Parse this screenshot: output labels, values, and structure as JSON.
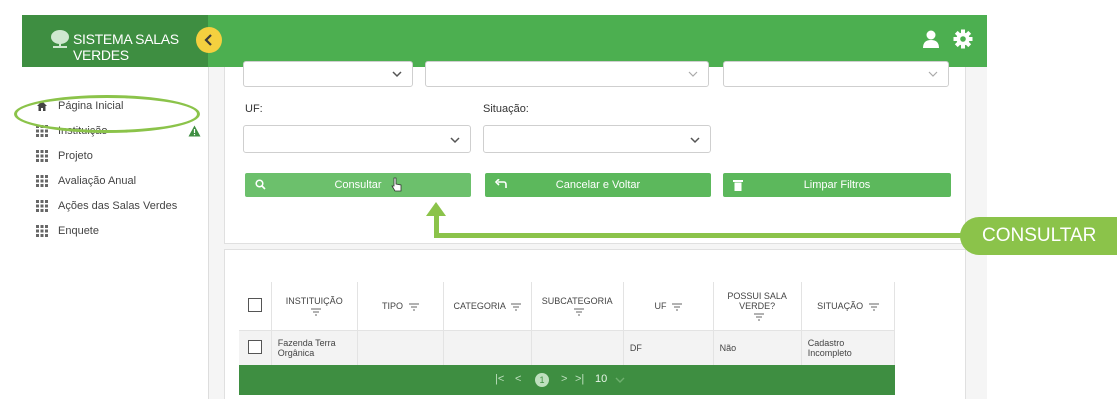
{
  "app": {
    "title": "SISTEMA SALAS VERDES"
  },
  "sidebar": {
    "items": [
      {
        "label": "Página Inicial",
        "icon": "home-icon"
      },
      {
        "label": "Instituição",
        "icon": "grid-icon",
        "badge_icon": "warning-icon"
      },
      {
        "label": "Projeto",
        "icon": "grid-icon"
      },
      {
        "label": "Avaliação Anual",
        "icon": "grid-icon"
      },
      {
        "label": "Ações das Salas Verdes",
        "icon": "grid-icon"
      },
      {
        "label": "Enquete",
        "icon": "grid-icon"
      }
    ]
  },
  "filters": {
    "uf_label": "UF:",
    "situacao_label": "Situação:",
    "uf_value": "",
    "situacao_value": ""
  },
  "actions": {
    "consultar": "Consultar",
    "cancelar": "Cancelar e Voltar",
    "limpar": "Limpar Filtros"
  },
  "table": {
    "columns": [
      "INSTITUIÇÃO",
      "TIPO",
      "CATEGORIA",
      "SUBCATEGORIA",
      "UF",
      "POSSUI SALA VERDE?",
      "SITUAÇÃO"
    ],
    "rows": [
      {
        "instituicao": "Fazenda Terra Orgânica",
        "tipo": "",
        "categoria": "",
        "subcategoria": "",
        "uf": "DF",
        "possui": "Não",
        "situacao": "Cadastro Incompleto"
      }
    ]
  },
  "pagination": {
    "current": "1",
    "page_size": "10"
  },
  "annotation": {
    "callout": "CONSULTAR"
  },
  "colors": {
    "primary": "#4caf50",
    "dark": "#3e8e41",
    "accent": "#8bc34a",
    "toggle": "#f4d03f"
  }
}
